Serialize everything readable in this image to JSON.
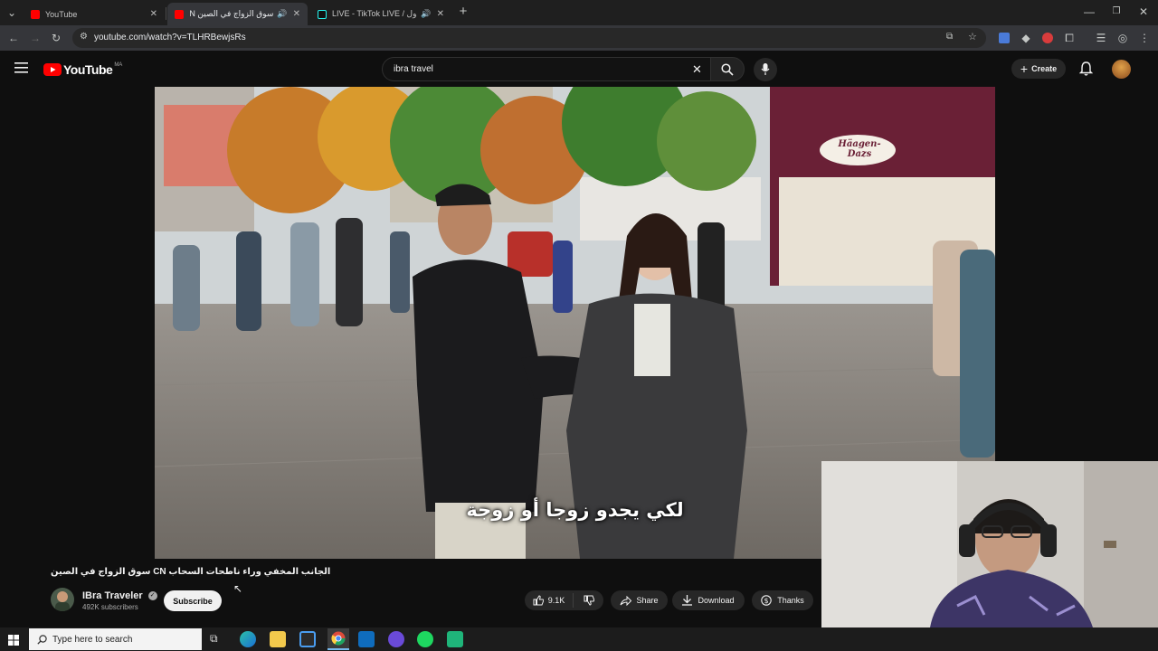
{
  "browser": {
    "tabs": [
      {
        "title": "YouTube",
        "active": false,
        "favicon": "youtube-icon"
      },
      {
        "title": "سوق الزواج في الصين CN ال...",
        "active": true,
        "favicon": "youtube-icon",
        "audio": true
      },
      {
        "title": "LIVE - TikTok LIVE / لعدول",
        "active": false,
        "favicon": "tiktok-icon",
        "audio": true
      }
    ],
    "new_tab": "+",
    "url": "youtube.com/watch?v=TLHRBewjsRs"
  },
  "youtube": {
    "logo_text": "YouTube",
    "region": "MA",
    "search_value": "ibra travel",
    "create_label": "Create"
  },
  "video": {
    "subtitle": "لكي يجدو زوجا أو زوجة",
    "storefront_text": "Häagen-Dazs",
    "title": "الجانب المخفي وراء ناطحات السحاب CN سوق الزواج في الصين",
    "channel": "IBra Traveler",
    "subscribers": "492K subscribers",
    "subscribe_label": "Subscribe",
    "likes": "9.1K",
    "share_label": "Share",
    "download_label": "Download",
    "thanks_label": "Thanks"
  },
  "taskbar": {
    "search_placeholder": "Type here to search"
  },
  "colors": {
    "yt_red": "#ff0000",
    "bg": "#0f0f0f",
    "pill": "#272727"
  }
}
